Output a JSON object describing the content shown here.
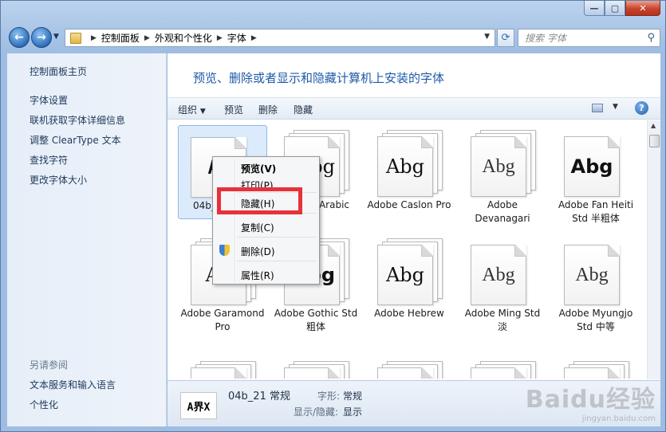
{
  "nav": {
    "breadcrumb": [
      "控制面板",
      "外观和个性化",
      "字体"
    ],
    "search_placeholder": "搜索 字体"
  },
  "sidebar": {
    "home": "控制面板主页",
    "links": [
      "字体设置",
      "联机获取字体详细信息",
      "调整 ClearType 文本",
      "查找字符",
      "更改字体大小"
    ],
    "see_also_title": "另请参阅",
    "see_also": [
      "文本服务和输入语言",
      "个性化"
    ]
  },
  "main": {
    "heading": "预览、删除或者显示和隐藏计算机上安装的字体",
    "toolbar": {
      "organize": "组织",
      "preview": "预览",
      "delete": "删除",
      "hide": "隐藏"
    },
    "fonts": [
      {
        "label": "04b_",
        "sample": "A5"
      },
      {
        "label": "Arabic",
        "sample": "bg"
      },
      {
        "label": "Adobe Caslon Pro",
        "sample": "Abg"
      },
      {
        "label": "Adobe Devanagari",
        "sample": "Abg"
      },
      {
        "label": "Adobe Fan Heiti Std 半粗体",
        "sample": "Abg"
      },
      {
        "label": "Adobe Garamond Pro",
        "sample": "Ab"
      },
      {
        "label": "Adobe Gothic Std 粗体",
        "sample": "bg"
      },
      {
        "label": "Adobe Hebrew",
        "sample": "Abg"
      },
      {
        "label": "Adobe Ming Std 淡",
        "sample": "Abg"
      },
      {
        "label": "Adobe Myungjo Std 中等",
        "sample": "Abg"
      }
    ]
  },
  "context_menu": {
    "items": [
      "预览(V)",
      "打印(P)",
      "隐藏(H)",
      "复制(C)",
      "删除(D)",
      "属性(R)"
    ]
  },
  "details": {
    "name": "04b_21 常规",
    "thumb": "A界X",
    "style_key": "字形:",
    "style_val": "常规",
    "visibility_key": "显示/隐藏:",
    "visibility_val": "显示"
  },
  "watermark": {
    "main": "Baidu经验",
    "sub": "jingyan.baidu.com"
  },
  "colors": {
    "accent_heading": "#1e5aa8",
    "highlight_box": "#e8313a"
  }
}
